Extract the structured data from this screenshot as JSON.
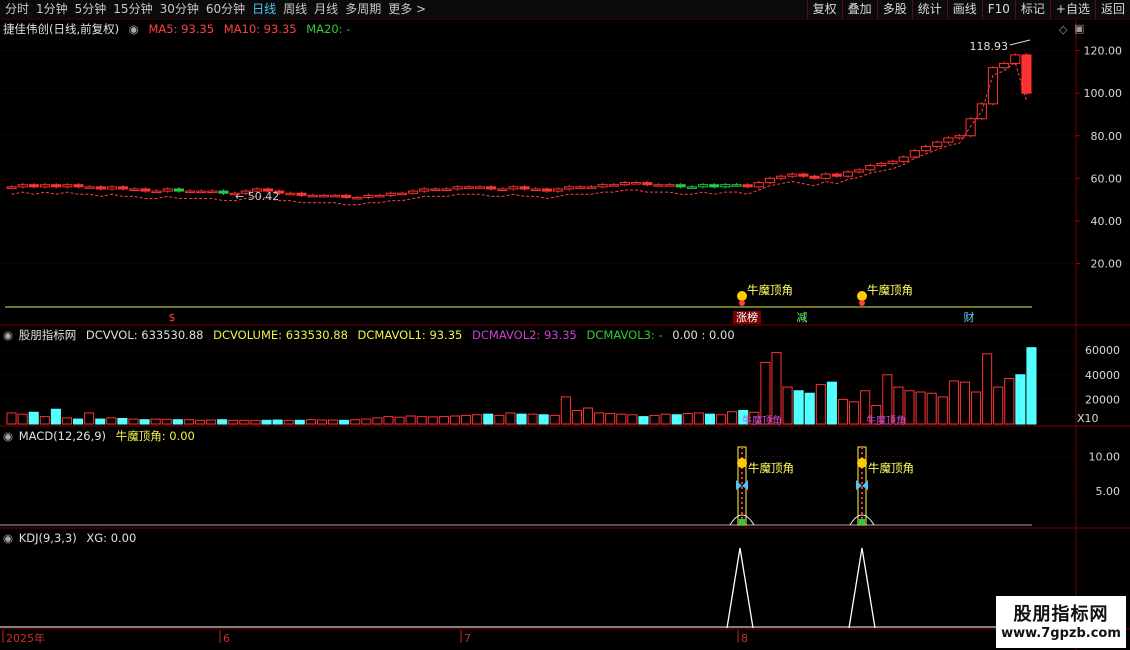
{
  "toolbar": {
    "periods": [
      "分时",
      "1分钟",
      "5分钟",
      "15分钟",
      "30分钟",
      "60分钟",
      "日线",
      "周线",
      "月线",
      "多周期",
      "更多 >"
    ],
    "active_period": "日线",
    "tools": [
      "复权",
      "叠加",
      "多股",
      "统计",
      "画线",
      "F10",
      "标记",
      "+自选",
      "返回"
    ]
  },
  "main_panel": {
    "title": "捷佳伟创(日线,前复权)",
    "ma5_label": "MA5: 93.35",
    "ma10_label": "MA10: 93.35",
    "ma20_label": "MA20: -",
    "high_marker": "118.93",
    "low_marker": "50.42",
    "y_ticks": [
      "120.00",
      "100.00",
      "80.00",
      "60.00",
      "40.00",
      "20.00"
    ],
    "signal_label_1": "牛魔顶角",
    "signal_label_2": "牛魔顶角",
    "bottom_markers": [
      "$",
      "涨榜",
      "减",
      "财"
    ]
  },
  "vol_panel": {
    "name": "股朋指标网",
    "dcvvol": "DCVVOL: 633530.88",
    "dcvolume": "DCVOLUME: 633530.88",
    "dcmavol1": "DCMAVOL1: 93.35",
    "dcmavol2": "DCMAVOL2: 93.35",
    "dcmavol3": "DCMAVOL3: -",
    "extra": "0.00 : 0.00",
    "y_ticks": [
      "60000",
      "40000",
      "20000"
    ],
    "unit": "X10",
    "overlay_1": "牛魔顶角",
    "overlay_2": "牛魔顶角"
  },
  "macd_panel": {
    "name": "MACD(12,26,9)",
    "value": "牛魔顶角: 0.00",
    "y_ticks": [
      "10.00",
      "5.00"
    ],
    "signal_label_1": "牛魔顶角",
    "signal_label_2": "牛魔顶角"
  },
  "kdj_panel": {
    "name": "KDJ(9,3,3)",
    "value": "XG: 0.00"
  },
  "date_axis": [
    "2025年",
    "6",
    "7",
    "8"
  ],
  "watermark": {
    "title": "股朋指标网",
    "url": "www.7gpzb.com"
  },
  "chart_data": {
    "type": "candlestick",
    "title": "捷佳伟创(日线,前复权)",
    "ylim": [
      0,
      125
    ],
    "closes": [
      56,
      57,
      56,
      57,
      56,
      57,
      56,
      56,
      55,
      56,
      55,
      55,
      54,
      54,
      55,
      54,
      54,
      54,
      54,
      53,
      53,
      54,
      55,
      54,
      53,
      53,
      52,
      52,
      52,
      52,
      51,
      51,
      52,
      52,
      53,
      53,
      54,
      55,
      55,
      55,
      56,
      56,
      56,
      55,
      55,
      56,
      55,
      55,
      54,
      55,
      56,
      56,
      56,
      57,
      57,
      58,
      58,
      57,
      57,
      57,
      56,
      56,
      57,
      56,
      57,
      57,
      56,
      58,
      60,
      61,
      62,
      61,
      60,
      62,
      61,
      63,
      64,
      66,
      67,
      68,
      70,
      73,
      75,
      77,
      79,
      80,
      88,
      95,
      112,
      114,
      118,
      100
    ]
  }
}
